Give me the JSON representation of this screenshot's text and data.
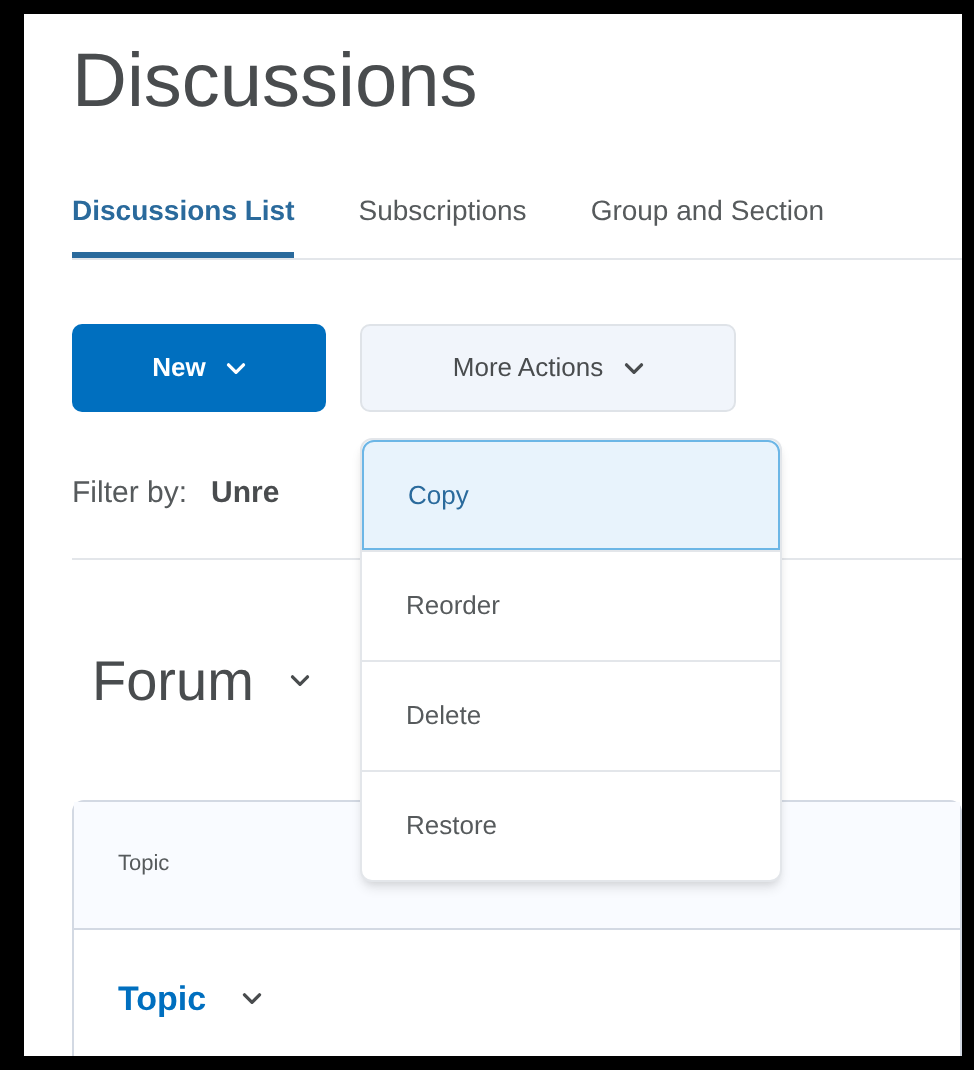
{
  "page_title": "Discussions",
  "tabs": [
    {
      "label": "Discussions List",
      "selected": true
    },
    {
      "label": "Subscriptions",
      "selected": false
    },
    {
      "label": "Group and Section",
      "selected": false
    }
  ],
  "buttons": [
    {
      "label": "New",
      "kind": "primary"
    },
    {
      "label": "More Actions",
      "kind": "secondary"
    }
  ],
  "menu": [
    {
      "label": "Copy",
      "selected": true
    },
    {
      "label": "Reorder",
      "selected": false
    },
    {
      "label": "Delete",
      "selected": false
    },
    {
      "label": "Restore",
      "selected": false
    }
  ],
  "filter": {
    "label": "Filter by:",
    "value": "Unre"
  },
  "forum": {
    "title": "Forum"
  },
  "table": {
    "columns": [
      "Topic"
    ],
    "rows": [
      {
        "title": "Topic"
      }
    ]
  }
}
